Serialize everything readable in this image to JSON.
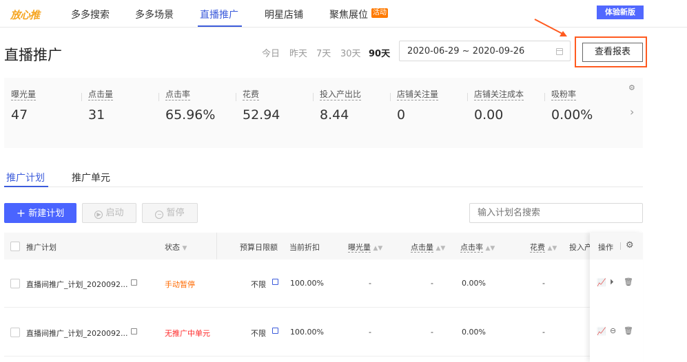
{
  "nav": {
    "logo": "放心推",
    "items": [
      "多多搜索",
      "多多场景",
      "直播推广",
      "明星店铺",
      "聚焦展位"
    ],
    "activity_badge": "活动",
    "new_version": "体验新版"
  },
  "page": {
    "title": "直播推广"
  },
  "date": {
    "ranges": [
      "今日",
      "昨天",
      "7天",
      "30天",
      "90天"
    ],
    "active_range": "90天",
    "value": "2020-06-29 ~ 2020-09-26",
    "report_button": "查看报表"
  },
  "stats": [
    {
      "label": "曝光量",
      "value": "47"
    },
    {
      "label": "点击量",
      "value": "31"
    },
    {
      "label": "点击率",
      "value": "65.96%"
    },
    {
      "label": "花费",
      "value": "52.94"
    },
    {
      "label": "投入产出比",
      "value": "8.44"
    },
    {
      "label": "店铺关注量",
      "value": "0"
    },
    {
      "label": "店铺关注成本",
      "value": "0.00"
    },
    {
      "label": "吸粉率",
      "value": "0.00%"
    }
  ],
  "tabs": [
    "推广计划",
    "推广单元"
  ],
  "toolbar": {
    "new_plan": "新建计划",
    "start": "启动",
    "pause": "暂停",
    "search_placeholder": "输入计划名搜索"
  },
  "table": {
    "headers": {
      "plan": "推广计划",
      "status": "状态",
      "budget": "预算日限额",
      "discount": "当前折扣",
      "impressions": "曝光量",
      "clicks": "点击量",
      "ctr": "点击率",
      "cost": "花费",
      "roi": "投入产",
      "ops": "操作"
    },
    "rows": [
      {
        "name": "直播间推广_计划_2020092...",
        "status": "手动暂停",
        "budget": "不限",
        "discount": "100.00%",
        "impressions": "-",
        "clicks": "-",
        "ctr": "0.00%",
        "cost": "-"
      },
      {
        "name": "直播间推广_计划_2020092...",
        "status": "无推广中单元",
        "budget": "不限",
        "discount": "100.00%",
        "impressions": "-",
        "clicks": "-",
        "ctr": "0.00%",
        "cost": "-"
      }
    ]
  },
  "colors": {
    "accent": "#4a64ff",
    "highlight_frame": "#ff5a1f",
    "status_paused": "#ff6a00",
    "status_error": "#ff2a2a"
  }
}
